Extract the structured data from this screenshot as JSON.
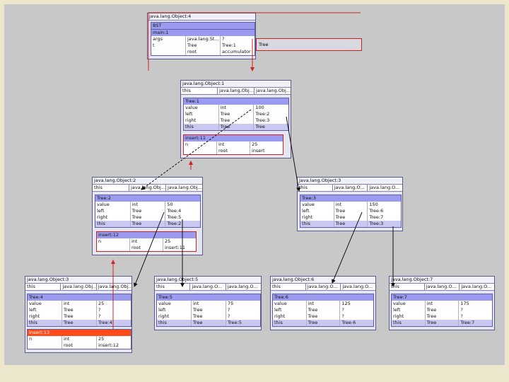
{
  "objects": [
    {
      "id": "obj4",
      "header": "java.lang.Object:4",
      "this_cells": [],
      "frames": [
        {
          "title": "BST",
          "rows": []
        },
        {
          "title": "main:1",
          "rows": [
            [
              "args",
              "java.lang.St...",
              "?"
            ],
            [
              "t",
              "Tree",
              "Tree:1"
            ],
            [
              "",
              "root",
              "accumulator"
            ]
          ]
        }
      ],
      "side_label": "Tree"
    },
    {
      "id": "obj1",
      "header": "java.lang.Object:1",
      "this_cells": [
        "this",
        "java.lang.Obj...",
        "java.lang.Obj..."
      ],
      "frames": [
        {
          "title": "Tree:1",
          "rows": [
            [
              "value",
              "int",
              "100"
            ],
            [
              "left",
              "Tree",
              "Tree:2"
            ],
            [
              "right",
              "Tree",
              "Tree:3"
            ],
            [
              "this",
              "Tree",
              "Tree"
            ]
          ]
        },
        {
          "title": "insert:11",
          "rows": [
            [
              "n",
              "int",
              "25"
            ],
            [
              "",
              "root",
              "insert"
            ]
          ]
        }
      ]
    },
    {
      "id": "obj2",
      "header": "java.lang.Object:2",
      "this_cells": [
        "this",
        "java.lang.Obj...",
        "java.lang.Obj..."
      ],
      "frames": [
        {
          "title": "Tree:2",
          "rows": [
            [
              "value",
              "int",
              "50"
            ],
            [
              "left",
              "Tree",
              "Tree:4"
            ],
            [
              "right",
              "Tree",
              "Tree:5"
            ],
            [
              "this",
              "Tree",
              "Tree:2"
            ]
          ]
        },
        {
          "title": "insert:12",
          "rows": [
            [
              "n",
              "int",
              "25"
            ],
            [
              "",
              "root",
              "insert:11"
            ]
          ]
        }
      ]
    },
    {
      "id": "obj3",
      "header": "java.lang.Object:3",
      "this_cells": [
        "this",
        "java.lang.O...",
        "java.lang.O..."
      ],
      "frames": [
        {
          "title": "Tree:3",
          "rows": [
            [
              "value",
              "int",
              "150"
            ],
            [
              "left",
              "Tree",
              "Tree:6"
            ],
            [
              "right",
              "Tree",
              "Tree:7"
            ],
            [
              "this",
              "Tree",
              "Tree:3"
            ]
          ]
        }
      ]
    },
    {
      "id": "obj_b1",
      "header": "java.lang.Object:3",
      "this_cells": [
        "this",
        "java.lang.Obj...",
        "java.lang.Obj..."
      ],
      "frames": [
        {
          "title": "Tree:4",
          "rows": [
            [
              "value",
              "int",
              "25"
            ],
            [
              "left",
              "Tree",
              "?"
            ],
            [
              "right",
              "Tree",
              "?"
            ],
            [
              "this",
              "Tree",
              "Tree:4"
            ]
          ]
        },
        {
          "title": "insert:13",
          "rows": [
            [
              "n",
              "int",
              "25"
            ],
            [
              "",
              "root",
              "insert:12"
            ]
          ]
        }
      ]
    },
    {
      "id": "obj5",
      "header": "java.lang.Object:5",
      "this_cells": [
        "this",
        "java.lang.O...",
        "java.lang.O..."
      ],
      "frames": [
        {
          "title": "Tree:5",
          "rows": [
            [
              "value",
              "int",
              "75"
            ],
            [
              "left",
              "Tree",
              "?"
            ],
            [
              "right",
              "Tree",
              "?"
            ],
            [
              "this",
              "Tree",
              "Tree:5"
            ]
          ]
        }
      ]
    },
    {
      "id": "obj6",
      "header": "java.lang.Object:6",
      "this_cells": [
        "this",
        "java.lang.O...",
        "java.lang.O..."
      ],
      "frames": [
        {
          "title": "Tree:6",
          "rows": [
            [
              "value",
              "int",
              "125"
            ],
            [
              "left",
              "Tree",
              "?"
            ],
            [
              "right",
              "Tree",
              "?"
            ],
            [
              "this",
              "Tree",
              "Tree:6"
            ]
          ]
        }
      ]
    },
    {
      "id": "obj7",
      "header": "java.lang.Object:7",
      "this_cells": [
        "this",
        "java.lang.O...",
        "java.lang.O..."
      ],
      "frames": [
        {
          "title": "Tree:7",
          "rows": [
            [
              "value",
              "int",
              "175"
            ],
            [
              "left",
              "Tree",
              "?"
            ],
            [
              "right",
              "Tree",
              "?"
            ],
            [
              "this",
              "Tree",
              "Tree:7"
            ]
          ]
        }
      ]
    }
  ],
  "colors": {
    "frame_header": "#9a9af0",
    "red": "#d02020",
    "orange": "#ff4a1a"
  }
}
